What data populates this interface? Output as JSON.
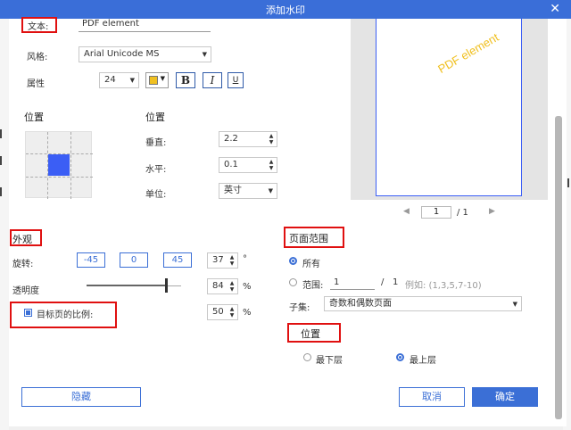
{
  "window": {
    "title": "添加水印",
    "close_glyph": "✕"
  },
  "text_section": {
    "label": "文本:",
    "value": "PDF element"
  },
  "style": {
    "label": "风格:",
    "font": "Arial Unicode MS"
  },
  "attributes": {
    "label": "属性",
    "size": "24",
    "bold": "B",
    "italic": "I",
    "underline": "U",
    "color": "#f0c020"
  },
  "position_grid": {
    "label": "位置"
  },
  "position": {
    "label": "位置",
    "vertical_label": "垂直:",
    "vertical_value": "2.2",
    "horizontal_label": "水平:",
    "horizontal_value": "0.1",
    "unit_label": "单位:",
    "unit_value": "英寸"
  },
  "preview": {
    "watermark_text": "PDF element",
    "page_current": "1",
    "page_total": "/ 1",
    "prev_glyph": "◀",
    "next_glyph": "▶"
  },
  "appearance": {
    "label": "外观",
    "rotation_label": "旋转:",
    "rotation_presets": [
      "-45",
      "0",
      "45"
    ],
    "rotation_value": "37",
    "rotation_unit": "°",
    "opacity_label": "透明度",
    "opacity_value": "84",
    "opacity_unit": "%",
    "opacity_fraction": 0.84,
    "scale_label": "目标页的比例:",
    "scale_value": "50",
    "scale_unit": "%",
    "scale_checked": true
  },
  "page_range": {
    "label": "页面范围",
    "all_label": "所有",
    "range_label": "范围:",
    "range_from": "1",
    "range_sep": "/",
    "range_total": "1",
    "example": "例如: (1,3,5,7-10)",
    "subset_label": "子集:",
    "subset_value": "奇数和偶数页面"
  },
  "layer": {
    "label": "位置",
    "bottom_label": "最下层",
    "top_label": "最上层"
  },
  "footer": {
    "hide_label": "隐藏",
    "cancel_label": "取消",
    "ok_label": "确定"
  },
  "colors": {
    "accent": "#3b6fd6",
    "titlebar": "#3a6ed8",
    "highlight_red": "#e01010"
  }
}
